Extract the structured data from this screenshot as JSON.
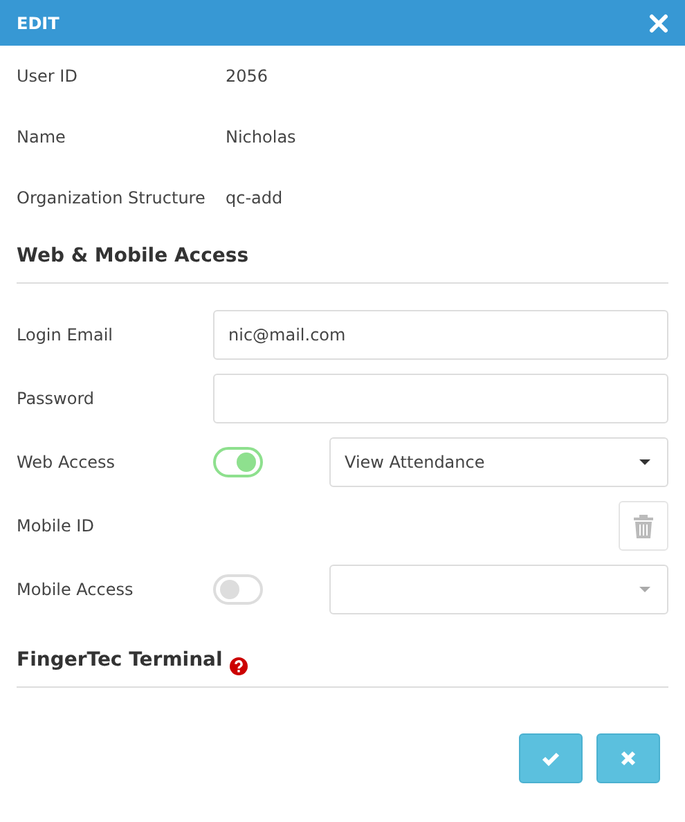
{
  "dialog": {
    "title": "EDIT"
  },
  "info_rows": [
    {
      "label": "User ID",
      "value": "2056"
    },
    {
      "label": "Name",
      "value": "Nicholas"
    },
    {
      "label": "Organization Structure",
      "value": "qc-add"
    }
  ],
  "web_mobile": {
    "heading": "Web & Mobile Access",
    "login_email": {
      "label": "Login Email",
      "value": "nic@mail.com"
    },
    "password": {
      "label": "Password"
    },
    "web_access": {
      "label": "Web Access",
      "on": true,
      "value": "View Attendance"
    },
    "mobile_id": {
      "label": "Mobile ID"
    },
    "mobile_access": {
      "label": "Mobile Access",
      "on": false
    }
  },
  "terminal": {
    "heading": "FingerTec Terminal"
  },
  "buttons": [
    {
      "kind": "confirm"
    },
    {
      "kind": "cancel"
    }
  ]
}
